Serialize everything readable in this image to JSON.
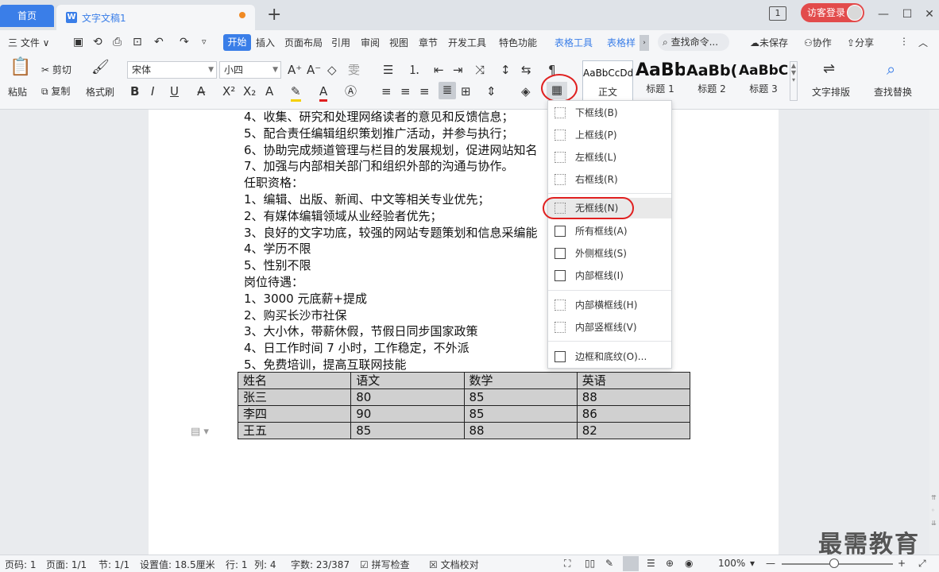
{
  "tabs": {
    "home": "首页",
    "doc_icon": "W",
    "doc_title": "文字文稿1",
    "add": "+"
  },
  "window": {
    "page_badge": "1",
    "visitor": "访客登录",
    "min": "—",
    "max": "☐",
    "close": "✕"
  },
  "menu": {
    "file": "三 文件 ∨",
    "items": [
      "插入",
      "页面布局",
      "引用",
      "审阅",
      "视图",
      "章节",
      "开发工具",
      "特色功能"
    ],
    "active": "开始",
    "table_tools": "表格工具",
    "table_style": "表格样",
    "search": "查找命令...",
    "unsaved": "未保存",
    "collab": "协作",
    "share": "分享"
  },
  "ribbon": {
    "paste": "粘贴",
    "cut": "剪切",
    "copy": "复制",
    "format_painter": "格式刷",
    "font": "宋体",
    "size": "小四",
    "styles": [
      {
        "sample": "AaBbCcDd",
        "name": "正文"
      },
      {
        "sample": "AaBb",
        "name": "标题 1"
      },
      {
        "sample": "AaBb(",
        "name": "标题 2"
      },
      {
        "sample": "AaBbC(",
        "name": "标题 3"
      }
    ],
    "text_layout": "文字排版",
    "find_replace": "查找替换"
  },
  "document": {
    "lines": [
      "4、收集、研究和处理网络读者的意见和反馈信息；",
      "5、配合责任编辑组织策划推广活动，并参与执行；",
      "6、协助完成频道管理与栏目的发展规划，促进网站知名",
      "7、加强与内部相关部门和组织外部的沟通与协作。",
      "任职资格：",
      "1、编辑、出版、新闻、中文等相关专业优先；",
      "2、有媒体编辑领域从业经验者优先；",
      "3、良好的文字功底，较强的网站专题策划和信息采编能",
      "4、学历不限",
      "5、性别不限",
      "岗位待遇：",
      "1、3000 元底薪+提成",
      "2、购买长沙市社保",
      "3、大小休，带薪休假，节假日同步国家政策",
      "4、日工作时间 7 小时，工作稳定，不外派",
      "5、免费培训，提高互联网技能"
    ],
    "table": [
      [
        "姓名",
        "语文",
        "数学",
        "英语"
      ],
      [
        "张三",
        "80",
        "85",
        "88"
      ],
      [
        "李四",
        "90",
        "85",
        "86"
      ],
      [
        "王五",
        "85",
        "88",
        "82"
      ]
    ]
  },
  "border_menu": {
    "items": [
      {
        "label": "下框线(B)",
        "icon": "bottom-border-icon"
      },
      {
        "label": "上框线(P)",
        "icon": "top-border-icon"
      },
      {
        "label": "左框线(L)",
        "icon": "left-border-icon"
      },
      {
        "label": "右框线(R)",
        "icon": "right-border-icon"
      },
      {
        "label": "无框线(N)",
        "icon": "no-border-icon"
      },
      {
        "label": "所有框线(A)",
        "icon": "all-borders-icon"
      },
      {
        "label": "外侧框线(S)",
        "icon": "outside-borders-icon"
      },
      {
        "label": "内部框线(I)",
        "icon": "inside-borders-icon"
      },
      {
        "label": "内部横框线(H)",
        "icon": "inside-horizontal-border-icon"
      },
      {
        "label": "内部竖框线(V)",
        "icon": "inside-vertical-border-icon"
      },
      {
        "label": "边框和底纹(O)...",
        "icon": "borders-shading-icon"
      }
    ]
  },
  "status": {
    "page_num": "页码: 1",
    "pages": "页面: 1/1",
    "section": "节: 1/1",
    "setting": "设置值: 18.5厘米",
    "row": "行: 1",
    "col": "列: 4",
    "words": "字数: 23/387",
    "spell": "拼写检查",
    "proof": "文档校对",
    "zoom": "100%"
  },
  "watermark": "最需教育",
  "colors": {
    "accent": "#3a7ee8",
    "highlight_circle": "#e02020",
    "visitor_btn": "#e24b4b"
  }
}
